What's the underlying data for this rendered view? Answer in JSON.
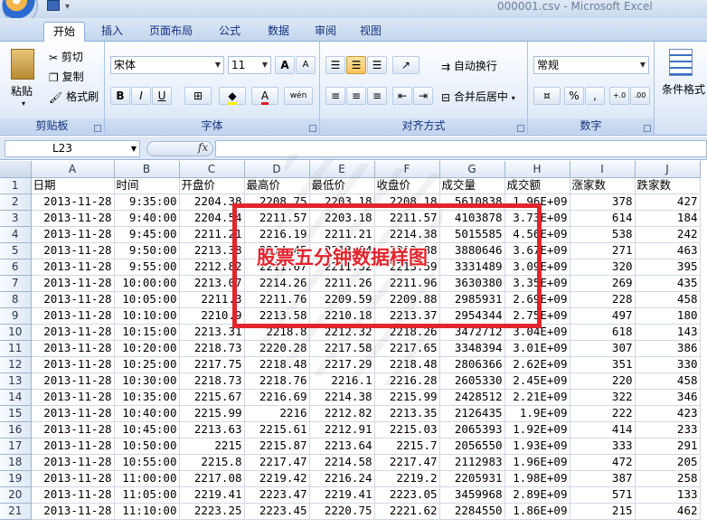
{
  "window": {
    "title": "000001.csv - Microsoft Excel"
  },
  "tabs": [
    "开始",
    "插入",
    "页面布局",
    "公式",
    "数据",
    "审阅",
    "视图"
  ],
  "ribbon": {
    "clipboard": {
      "label": "剪贴板",
      "paste": "粘贴",
      "cut": "剪切",
      "copy": "复制",
      "format_painter": "格式刷"
    },
    "font": {
      "label": "字体",
      "font_name": "宋体",
      "font_size": "11",
      "bold": "B",
      "italic": "I",
      "underline": "U",
      "grow": "A",
      "shrink": "A",
      "phonetic": "wén"
    },
    "alignment": {
      "label": "对齐方式",
      "wrap_text": "自动换行",
      "merge_center": "合并后居中"
    },
    "number": {
      "label": "数字",
      "format": "常规",
      "percent": "%",
      "comma": ",",
      "inc_decimal": "+.0",
      "dec_decimal": ".00"
    },
    "styles": {
      "cond_format": "条件格式"
    }
  },
  "formula_bar": {
    "name_box": "L23",
    "fx": "fx",
    "formula": ""
  },
  "columns": [
    "A",
    "B",
    "C",
    "D",
    "E",
    "F",
    "G",
    "H",
    "I",
    "J"
  ],
  "headers": [
    "日期",
    "时间",
    "开盘价",
    "最高价",
    "最低价",
    "收盘价",
    "成交量",
    "成交额",
    "涨家数",
    "跌家数"
  ],
  "rows": [
    [
      "2013-11-28",
      "9:35:00",
      "2204.38",
      "2208.75",
      "2203.18",
      "2208.18",
      "5610838",
      "1.96E+09",
      "378",
      "427"
    ],
    [
      "2013-11-28",
      "9:40:00",
      "2204.54",
      "2211.57",
      "2203.18",
      "2211.57",
      "4103878",
      "3.73E+09",
      "614",
      "184"
    ],
    [
      "2013-11-28",
      "9:45:00",
      "2211.21",
      "2216.19",
      "2211.21",
      "2214.38",
      "5015585",
      "4.56E+09",
      "538",
      "242"
    ],
    [
      "2013-11-28",
      "9:50:00",
      "2213.38",
      "2214.45",
      "2213.04",
      "2213.88",
      "3880646",
      "3.67E+09",
      "271",
      "463"
    ],
    [
      "2013-11-28",
      "9:55:00",
      "2212.82",
      "2211.67",
      "2211.32",
      "2213.59",
      "3331489",
      "3.09E+09",
      "320",
      "395"
    ],
    [
      "2013-11-28",
      "10:00:00",
      "2213.07",
      "2214.26",
      "2211.26",
      "2211.96",
      "3630380",
      "3.35E+09",
      "269",
      "435"
    ],
    [
      "2013-11-28",
      "10:05:00",
      "2211.3",
      "2211.76",
      "2209.59",
      "2209.88",
      "2985931",
      "2.69E+09",
      "228",
      "458"
    ],
    [
      "2013-11-28",
      "10:10:00",
      "2210.9",
      "2213.58",
      "2210.18",
      "2213.37",
      "2954344",
      "2.75E+09",
      "497",
      "180"
    ],
    [
      "2013-11-28",
      "10:15:00",
      "2213.31",
      "2218.8",
      "2212.32",
      "2218.26",
      "3472712",
      "3.04E+09",
      "618",
      "143"
    ],
    [
      "2013-11-28",
      "10:20:00",
      "2218.73",
      "2220.28",
      "2217.58",
      "2217.65",
      "3348394",
      "3.01E+09",
      "307",
      "386"
    ],
    [
      "2013-11-28",
      "10:25:00",
      "2217.75",
      "2218.48",
      "2217.29",
      "2218.48",
      "2806366",
      "2.62E+09",
      "351",
      "330"
    ],
    [
      "2013-11-28",
      "10:30:00",
      "2218.73",
      "2218.76",
      "2216.1",
      "2216.28",
      "2605330",
      "2.45E+09",
      "220",
      "458"
    ],
    [
      "2013-11-28",
      "10:35:00",
      "2215.67",
      "2216.69",
      "2214.38",
      "2215.99",
      "2428512",
      "2.21E+09",
      "322",
      "346"
    ],
    [
      "2013-11-28",
      "10:40:00",
      "2215.99",
      "2216",
      "2212.82",
      "2213.35",
      "2126435",
      "1.9E+09",
      "222",
      "423"
    ],
    [
      "2013-11-28",
      "10:45:00",
      "2213.63",
      "2215.61",
      "2212.91",
      "2215.03",
      "2065393",
      "1.92E+09",
      "414",
      "233"
    ],
    [
      "2013-11-28",
      "10:50:00",
      "2215",
      "2215.87",
      "2213.64",
      "2215.7",
      "2056550",
      "1.93E+09",
      "333",
      "291"
    ],
    [
      "2013-11-28",
      "10:55:00",
      "2215.8",
      "2217.47",
      "2214.58",
      "2217.47",
      "2112983",
      "1.96E+09",
      "472",
      "205"
    ],
    [
      "2013-11-28",
      "11:00:00",
      "2217.08",
      "2219.42",
      "2216.24",
      "2219.2",
      "2205931",
      "1.98E+09",
      "387",
      "258"
    ],
    [
      "2013-11-28",
      "11:05:00",
      "2219.41",
      "2223.47",
      "2219.41",
      "2223.05",
      "3459968",
      "2.89E+09",
      "571",
      "133"
    ],
    [
      "2013-11-28",
      "11:10:00",
      "2223.25",
      "2223.45",
      "2220.75",
      "2221.62",
      "2284550",
      "1.86E+09",
      "215",
      "462"
    ]
  ],
  "annotation": {
    "caption": "股票五分钟数据样图",
    "color": "#e1252d"
  }
}
